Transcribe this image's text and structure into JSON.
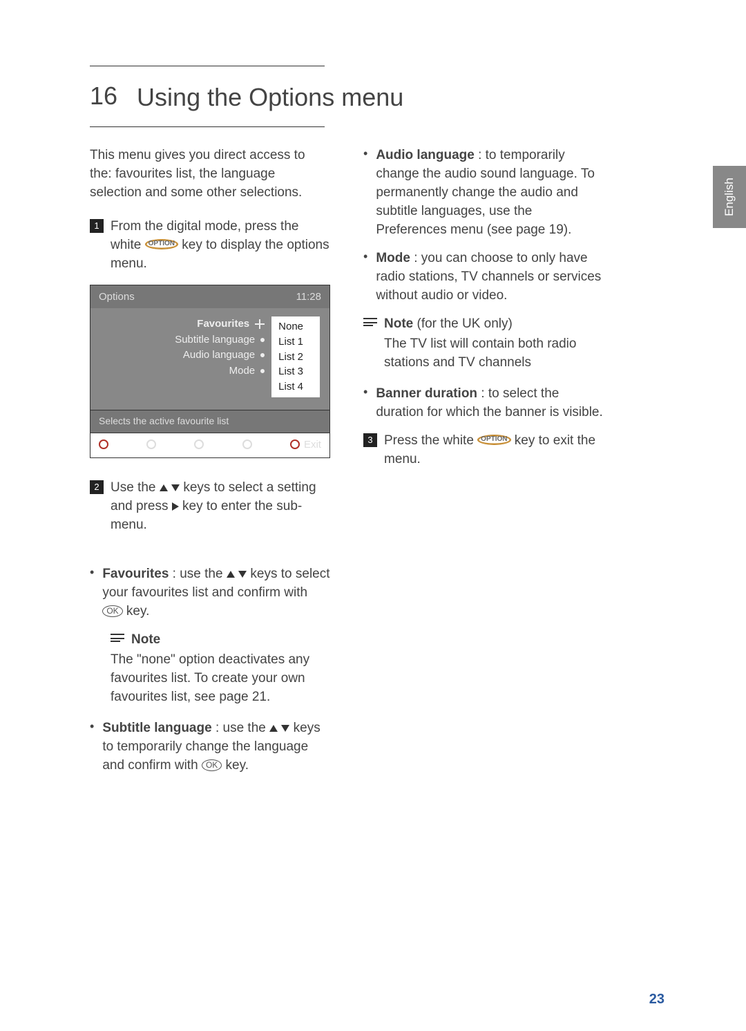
{
  "section": {
    "number": "16",
    "title": "Using the Options menu"
  },
  "intro": "This menu gives you direct access to the: favourites list, the language selection and some other selections.",
  "step1": {
    "prefix": "From the digital mode, press the white ",
    "key": "OPTION",
    "suffix": " key to display the options menu."
  },
  "options_panel": {
    "title": "Options",
    "time": "11:28",
    "labels": {
      "favourites": "Favourites",
      "subtitle": "Subtitle language",
      "audio": "Audio language",
      "mode": "Mode"
    },
    "values": [
      "None",
      "List 1",
      "List 2",
      "List 3",
      "List 4"
    ],
    "hint": "Selects the active favourite list",
    "exit": "Exit"
  },
  "step2": "Use the Î ï keys to select a setting and press Æ key to enter the sub-menu.",
  "favourites": {
    "label": "Favourites",
    "text": " : use the Î ï keys to select your favourites list and confirm with ",
    "ok": "OK",
    "suffix": " key."
  },
  "note1": {
    "label": "Note",
    "text": "The \"none\" option deactivates any favourites list. To create your own favourites list, see page 21."
  },
  "subtitle_lang": {
    "label": "Subtitle language",
    "text": " : use the Î ï keys to temporarily change the language and confirm with ",
    "ok": "OK",
    "suffix": " key."
  },
  "audio_lang": {
    "label": "Audio language",
    "text": " : to temporarily change the audio sound language. To permanently change the audio and subtitle languages, use the Preferences menu (see page 19)."
  },
  "mode": {
    "label": "Mode",
    "text": " : you can choose to only have radio stations, TV channels or services without audio or video."
  },
  "note2": {
    "label": "Note",
    "suffix": " (for the UK only)",
    "text": "The TV list will contain both radio stations and TV channels"
  },
  "banner": {
    "label": "Banner duration",
    "text": " : to select the duration for which the banner is visible."
  },
  "step3": {
    "prefix": "Press the white ",
    "key": "OPTION",
    "suffix": " key to exit the menu."
  },
  "lang_tab": "English",
  "page_number": "23"
}
